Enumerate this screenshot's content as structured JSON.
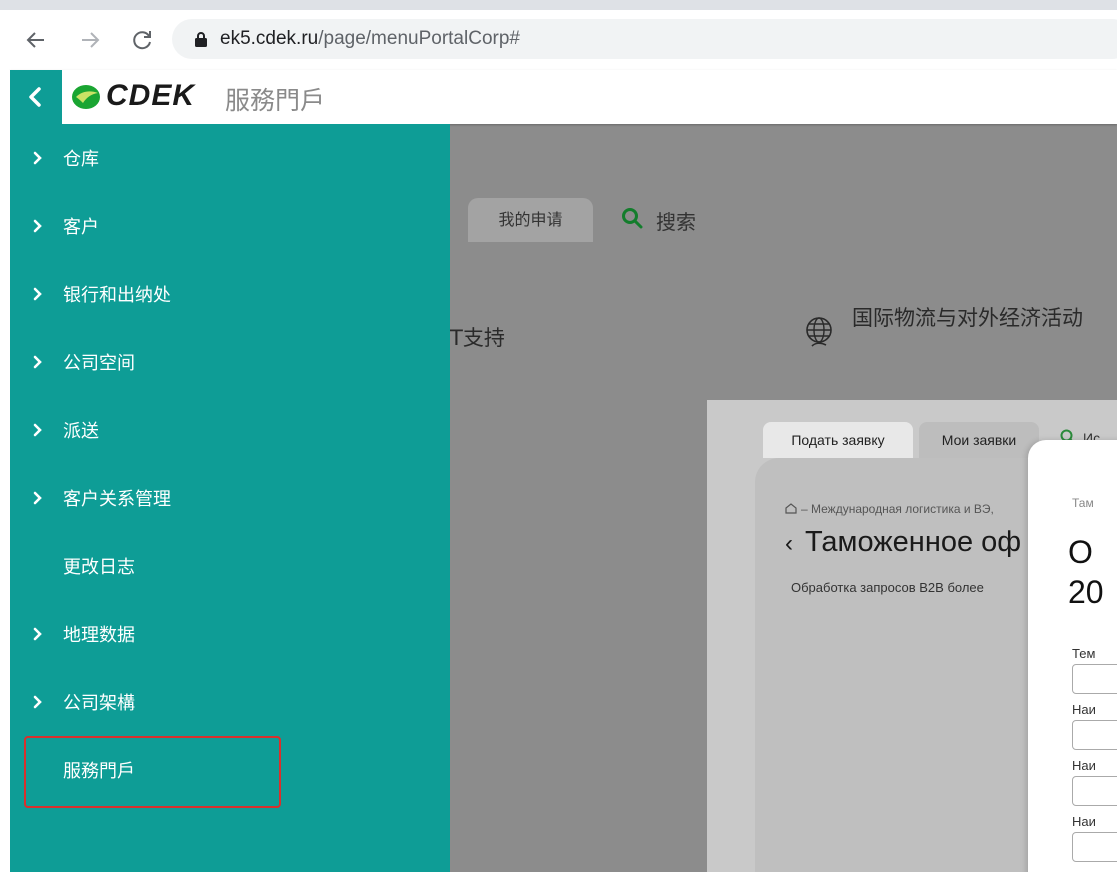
{
  "browser": {
    "url_host": "ek5.cdek.ru",
    "url_path": "/page/menuPortalCorp#"
  },
  "header": {
    "logo_text": "CDEK",
    "title": "服務門戶"
  },
  "sidebar": {
    "items": [
      {
        "label": "仓库",
        "has_children": true
      },
      {
        "label": "客户",
        "has_children": true
      },
      {
        "label": "银行和出纳处",
        "has_children": true
      },
      {
        "label": "公司空间",
        "has_children": true
      },
      {
        "label": "派送",
        "has_children": true
      },
      {
        "label": "客户关系管理",
        "has_children": true
      },
      {
        "label": "更改日志",
        "has_children": false
      },
      {
        "label": "地理数据",
        "has_children": true
      },
      {
        "label": "公司架構",
        "has_children": true
      },
      {
        "label": "服務門戶",
        "has_children": false,
        "highlighted": true
      }
    ]
  },
  "background_page": {
    "tab_my_requests": "我的申请",
    "search_label": "搜索",
    "it_support": "T支持",
    "intl_logistics": "国际物流与对外经济活动"
  },
  "inset_page": {
    "tab_submit": "Подать заявку",
    "tab_mine": "Мои заявки",
    "search_partial": "Ис",
    "breadcrumb": "– Международная логистика и ВЭ,",
    "heading": "Таможенное оф",
    "description": "Обработка запросов B2B более"
  },
  "inset_modal": {
    "breadcrumb_partial": "Там",
    "heading_line1": "О",
    "heading_line2": "20",
    "field_label_1": "Тем",
    "field_label_2": "Наи",
    "field_label_3": "Наи",
    "field_label_4": "Наи"
  },
  "colors": {
    "sidebar_bg": "#0e9d96",
    "highlight_border": "#d9302c",
    "accent_green": "#1a9e3a"
  }
}
